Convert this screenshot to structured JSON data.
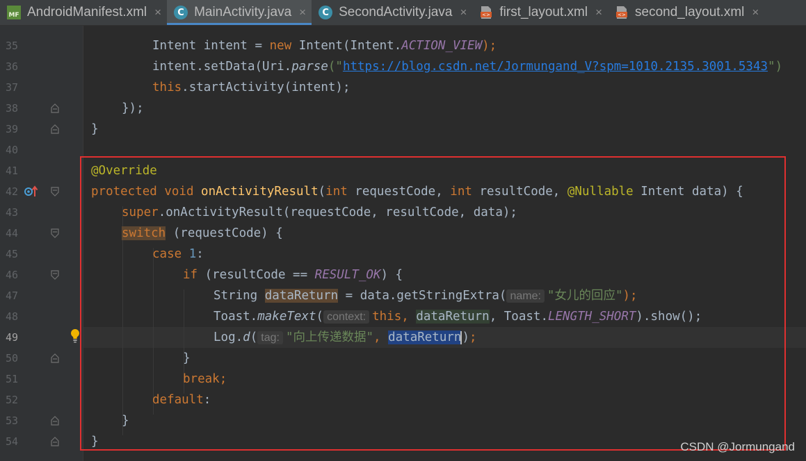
{
  "tabs": [
    {
      "label": "AndroidManifest.xml",
      "icon": "manifest-file-icon",
      "active": false
    },
    {
      "label": "MainActivity.java",
      "icon": "java-class-icon",
      "active": true
    },
    {
      "label": "SecondActivity.java",
      "icon": "java-class-icon",
      "active": false
    },
    {
      "label": "first_layout.xml",
      "icon": "layout-xml-icon",
      "active": false
    },
    {
      "label": "second_layout.xml",
      "icon": "layout-xml-icon",
      "active": false
    }
  ],
  "tab_close_glyph": "×",
  "icon_text": {
    "manifest": "MF",
    "java_class": "C"
  },
  "line_numbers": [
    "35",
    "36",
    "37",
    "38",
    "39",
    "40",
    "41",
    "42",
    "43",
    "44",
    "45",
    "46",
    "47",
    "48",
    "49",
    "50",
    "51",
    "52",
    "53",
    "54"
  ],
  "current_line": "49",
  "code": {
    "l35": {
      "t1": "Intent intent = ",
      "t2": "new",
      "t3": " Intent(Intent.",
      "t4": "ACTION_VIEW",
      "t5": ");"
    },
    "l36": {
      "t1": "intent.setData(Uri.",
      "t2": "parse",
      "t3": "(\"",
      "t4": "https://blog.csdn.net/Jormungand_V?spm=1010.2135.3001.5343",
      "t5": "\")"
    },
    "l37": {
      "t1": "this",
      "t2": ".startActivity(intent);"
    },
    "l38": {
      "t1": "});"
    },
    "l39": {
      "t1": "}"
    },
    "l41": {
      "t1": "@Override"
    },
    "l42": {
      "t1": "protected void ",
      "t2": "onActivityResult",
      "t3": "(",
      "t4": "int ",
      "t5": "requestCode, ",
      "t6": "int ",
      "t7": "resultCode, ",
      "t8": "@Nullable ",
      "t9": "Intent data) {"
    },
    "l43": {
      "t1": "super",
      "t2": ".onActivityResult(requestCode, resultCode, data);"
    },
    "l44": {
      "t1": "switch",
      "t2": " (requestCode) {"
    },
    "l45": {
      "t1": "case ",
      "t2": "1",
      "t3": ":"
    },
    "l46": {
      "t1": "if ",
      "t2": "(resultCode == ",
      "t3": "RESULT_OK",
      "t4": ") {"
    },
    "l47": {
      "t1": "String ",
      "t2": "dataReturn",
      "t3": " = data.getStringExtra(",
      "hint": "name:",
      "t4": "\"女儿的回应\"",
      "t5": ");"
    },
    "l48": {
      "t1": "Toast.",
      "t2": "makeText",
      "t3": "(",
      "hint": "context:",
      "t4": "this",
      "t5": ", ",
      "t6": "dataReturn",
      "t7": ", Toast.",
      "t8": "LENGTH_SHORT",
      "t9": ").show();"
    },
    "l49": {
      "t1": "Log.",
      "t2": "d",
      "t3": "(",
      "hint": "tag:",
      "t4": "\"向上传递数据\"",
      "t5": ", ",
      "t6": "dataReturn",
      "t7": ")",
      "t8": ";"
    },
    "l50": {
      "t1": "}"
    },
    "l51": {
      "t1": "break",
      "t2": ";"
    },
    "l52": {
      "t1": "default",
      "t2": ":"
    },
    "l53": {
      "t1": "}"
    },
    "l54": {
      "t1": "}"
    }
  },
  "watermark": "CSDN @Jormungand",
  "colors": {
    "background": "#2b2b2b",
    "keyword": "#cc7832",
    "method_decl": "#ffc66d",
    "annotation": "#bbb529",
    "string": "#6a8759",
    "number": "#6897bb",
    "constant": "#9876aa",
    "highlight_box": "#e03030",
    "active_tab_underline": "#4a88c7"
  }
}
